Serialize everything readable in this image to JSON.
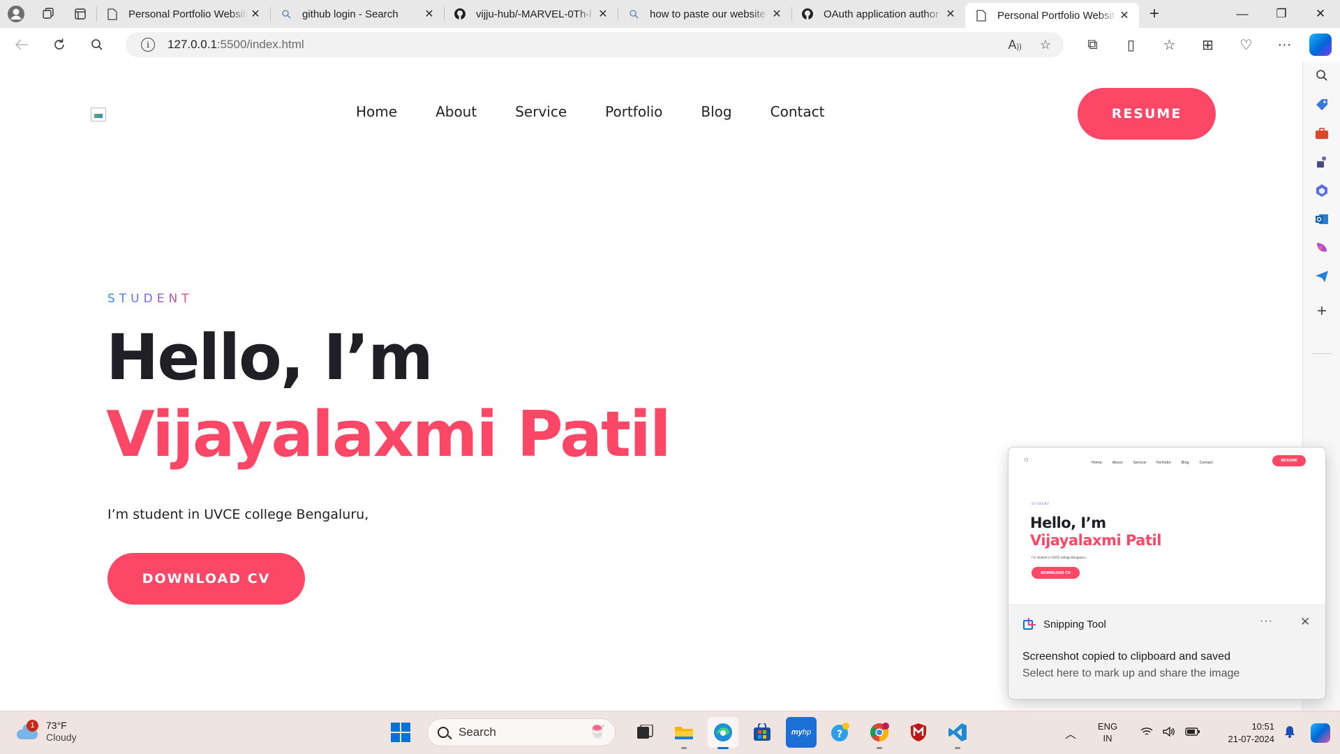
{
  "browser": {
    "tabs": [
      {
        "title": "Personal Portfolio Website",
        "icon": "page-icon",
        "active": false
      },
      {
        "title": "github login - Search",
        "icon": "search-icon",
        "active": false
      },
      {
        "title": "vijju-hub/-MARVEL-0Th-l",
        "icon": "github-icon",
        "active": false
      },
      {
        "title": "how to paste our website",
        "icon": "search-icon",
        "active": false
      },
      {
        "title": "OAuth application author",
        "icon": "github-icon",
        "active": false
      },
      {
        "title": "Personal Portfolio Websit",
        "icon": "page-icon",
        "active": true
      }
    ],
    "address": {
      "host": "127.0.0.1",
      "path": ":5500/index.html"
    }
  },
  "site": {
    "nav": [
      "Home",
      "About",
      "Service",
      "Portfolio",
      "Blog",
      "Contact"
    ],
    "resume_label": "RESUME",
    "hero": {
      "subtitle": "STUDENT",
      "greeting": "Hello, I’m",
      "name": "Vijayalaxmi Patil",
      "description": "I’m student in UVCE college Bengaluru,",
      "cta_label": "DOWNLOAD CV"
    },
    "colors": {
      "accent": "#fd4766",
      "heading": "#1f1f25"
    }
  },
  "toast": {
    "app_name": "Snipping Tool",
    "more_label": "···",
    "title": "Screenshot copied to clipboard and saved",
    "body": "Select here to mark up and share the image"
  },
  "taskbar": {
    "weather": {
      "temp": "73°F",
      "condition": "Cloudy",
      "badge": "1"
    },
    "search_placeholder": "Search",
    "lang": {
      "line1": "ENG",
      "line2": "IN"
    },
    "clock": {
      "time": "10:51",
      "date": "21-07-2024"
    },
    "apps": [
      "task-view-icon",
      "file-explorer-icon",
      "edge-icon",
      "store-icon",
      "myhp-icon",
      "tips-icon",
      "chrome-icon",
      "mcafee-icon",
      "vscode-icon"
    ]
  }
}
